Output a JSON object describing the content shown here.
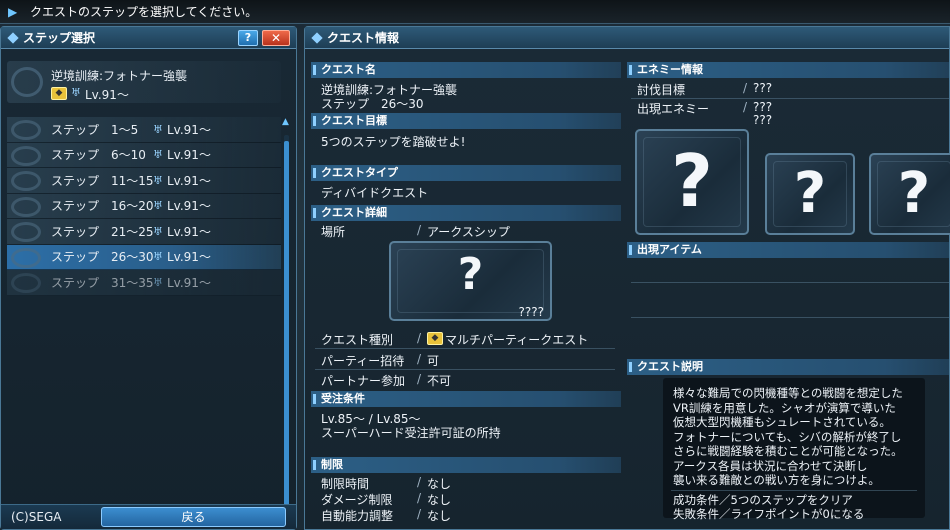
{
  "topbar": {
    "message": "クエストのステップを選択してください。"
  },
  "left": {
    "title": "ステップ選択",
    "help_label": "?",
    "close_label": "✕",
    "quest": {
      "name": "逆境訓練:フォトナー強襲",
      "lv": "Lv.91〜"
    },
    "steps": [
      {
        "name": "ステップ　1〜5",
        "lv": "Lv.91〜"
      },
      {
        "name": "ステップ　6〜10",
        "lv": "Lv.91〜"
      },
      {
        "name": "ステップ　11〜15",
        "lv": "Lv.91〜"
      },
      {
        "name": "ステップ　16〜20",
        "lv": "Lv.91〜"
      },
      {
        "name": "ステップ　21〜25",
        "lv": "Lv.91〜"
      },
      {
        "name": "ステップ　26〜30",
        "lv": "Lv.91〜"
      },
      {
        "name": "ステップ　31〜35",
        "lv": "Lv.91〜"
      }
    ],
    "copyright": "(C)SEGA",
    "back_label": "戻る"
  },
  "right": {
    "title": "クエスト情報",
    "quest_name_head": "クエスト名",
    "quest_name": "逆境訓練:フォトナー強襲",
    "quest_step": "ステップ　26〜30",
    "goal_head": "クエスト目標",
    "goal": "5つのステップを踏破せよ!",
    "type_head": "クエストタイプ",
    "type": "ディバイドクエスト",
    "detail_head": "クエスト詳細",
    "location_label": "場所",
    "location_value": "アークスシップ",
    "location_card_q": "?",
    "location_card_name": "????",
    "kind_label": "クエスト種別",
    "kind_value": "マルチパーティークエスト",
    "party_label": "パーティー招待",
    "party_value": "可",
    "partner_label": "パートナー参加",
    "partner_value": "不可",
    "req_head": "受注条件",
    "req_lv": "Lv.85〜 / Lv.85〜",
    "req_permit": "スーパーハード受注許可証の所持",
    "limit_head": "制限",
    "limits": [
      {
        "label": "制限時間",
        "value": "なし"
      },
      {
        "label": "ダメージ制限",
        "value": "なし"
      },
      {
        "label": "自動能力調整",
        "value": "なし"
      }
    ],
    "enemy_head": "エネミー情報",
    "target_label": "討伐目標",
    "target_value": "???",
    "enemy_label": "出現エネミー",
    "enemy_values": [
      "???",
      "???"
    ],
    "enemy_card_q": "?",
    "item_head": "出現アイテム",
    "desc_head": "クエスト説明",
    "desc_lines": [
      "様々な難局での閃機種等との戦闘を想定した",
      "VR訓練を用意した。シャオが演算で導いた",
      "仮想大型閃機種もシュレートされている。",
      "フォトナーについても、シバの解析が終了し",
      "さらに戦闘経験を積むことが可能となった。",
      "アークス各員は状況に合わせて決断し",
      "襲い来る難敵との戦い方を身につけよ。"
    ],
    "success": "成功条件／5つのステップをクリア",
    "failure": "失敗条件／ライフポイントが0になる",
    "slash": "/"
  }
}
